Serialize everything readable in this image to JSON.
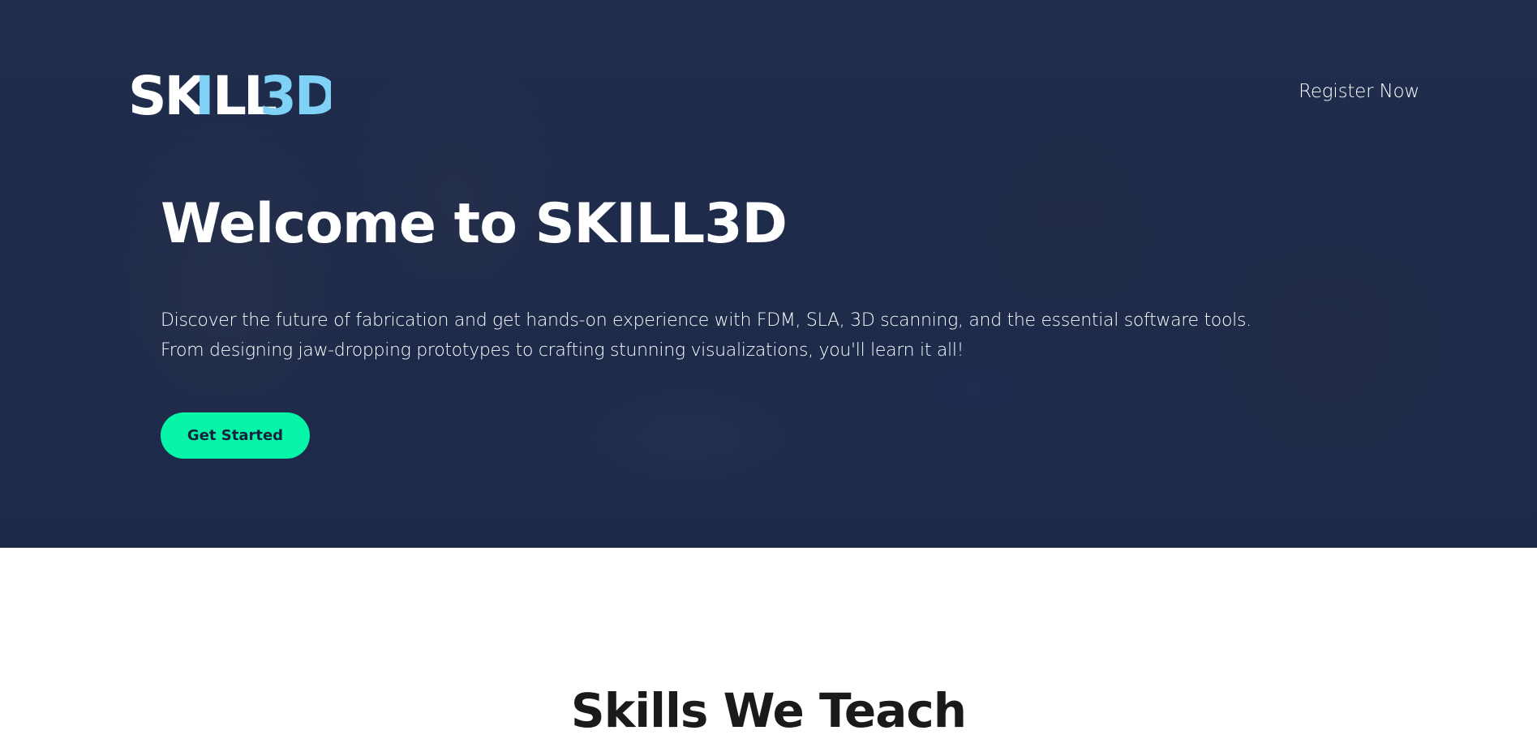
{
  "brand": {
    "logo_text_white": "SK",
    "logo_text_blue_i": "I",
    "logo_text_white2": "LL",
    "logo_text_blue": "3D",
    "colors": {
      "white": "#ffffff",
      "accent_blue": "#7fd1f5",
      "cta_green": "#06f5a8",
      "overlay": "#1c2848"
    }
  },
  "nav": {
    "register_label": "Register Now"
  },
  "hero": {
    "title": "Welcome to SKILL3D",
    "description_line1": "Discover the future of fabrication and get hands-on experience with FDM, SLA, 3D scanning, and the essential software tools.",
    "description_line2": "From designing jaw-dropping prototypes to crafting stunning visualizations, you'll learn it all!",
    "cta_label": "Get Started",
    "background": "classroom-photo"
  },
  "skills_section": {
    "title": "Skills We Teach"
  }
}
